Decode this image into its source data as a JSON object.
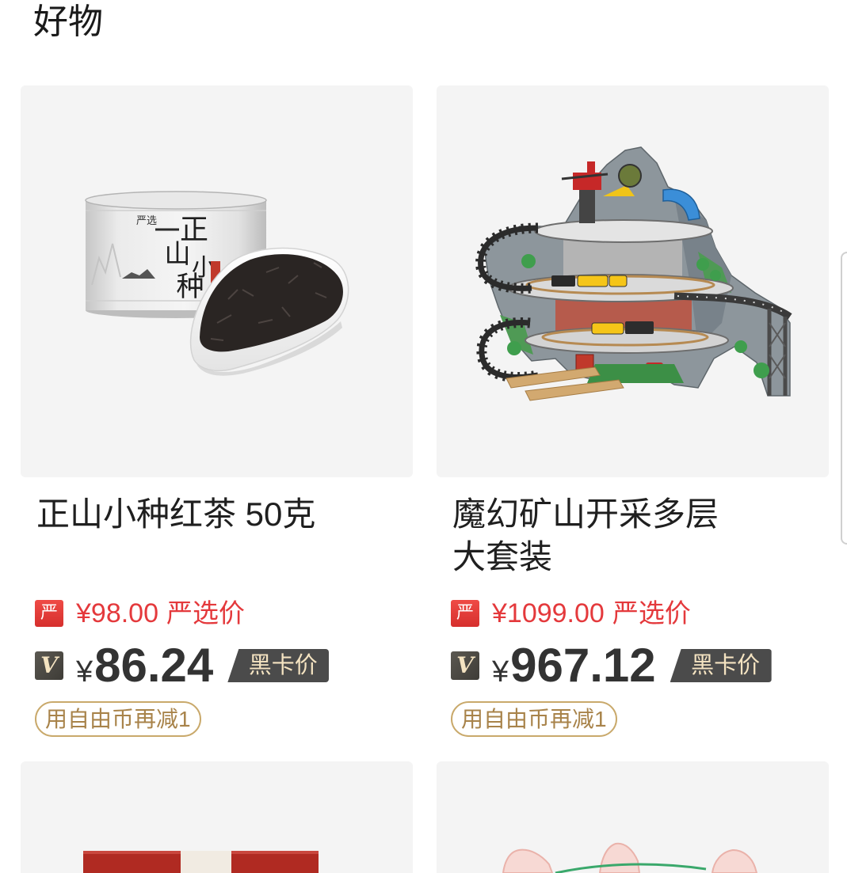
{
  "header": {
    "title": "好物"
  },
  "colors": {
    "price_red": "#e4393c",
    "vip_dark": "#4b4b4b",
    "vip_text": "#f4e3c1",
    "coupon_gold": "#c9a96b",
    "coupon_text": "#a8834a",
    "image_bg": "#f4f4f4"
  },
  "products": [
    {
      "title_lines": [
        "正山小种红茶 50克"
      ],
      "image": {
        "icon": "tea-can-image",
        "brand": "严选",
        "can_chars": [
          "正",
          "山",
          "小",
          "种"
        ]
      },
      "yanxuan": {
        "icon": "yanxuan-logo-icon",
        "icon_text": "严",
        "price": "¥98.00",
        "label": "严选价"
      },
      "vip": {
        "icon": "vip-v-icon",
        "icon_text": "V",
        "currency": "¥",
        "price": "86.24",
        "label": "黑卡价"
      },
      "coupon": "用自由币再减1"
    },
    {
      "title_lines": [
        "魔幻矿山开采多层",
        "大套装"
      ],
      "image": {
        "icon": "mine-train-set-image"
      },
      "yanxuan": {
        "icon": "yanxuan-logo-icon",
        "icon_text": "严",
        "price": "¥1099.00",
        "label": "严选价"
      },
      "vip": {
        "icon": "vip-v-icon",
        "icon_text": "V",
        "currency": "¥",
        "price": "967.12",
        "label": "黑卡价"
      },
      "coupon": "用自由币再减1"
    },
    {
      "image": {
        "icon": "red-gift-box-image"
      }
    },
    {
      "image": {
        "icon": "plush-toy-image"
      }
    }
  ]
}
